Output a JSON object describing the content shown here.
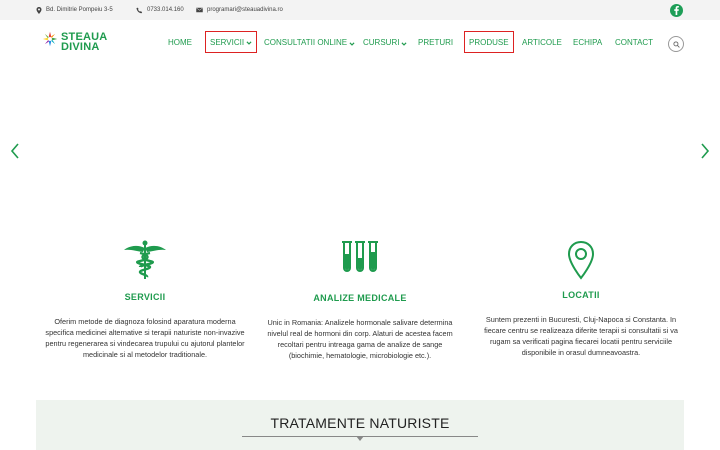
{
  "topbar": {
    "address": "Bd. Dimitrie Pompeiu 3-5",
    "phone": "0733.014.160",
    "email": "programari@steauadivina.ro",
    "social_icon": "facebook-icon"
  },
  "logo": {
    "line1": "STEAUA",
    "line2": "DIVINA"
  },
  "nav": {
    "items": [
      {
        "label": "HOME"
      },
      {
        "label": "SERVICII"
      },
      {
        "label": "CONSULTATII ONLINE"
      },
      {
        "label": "CURSURI"
      },
      {
        "label": "PRETURI"
      },
      {
        "label": "PRODUSE"
      },
      {
        "label": "ARTICOLE"
      },
      {
        "label": "ECHIPA"
      },
      {
        "label": "CONTACT"
      }
    ]
  },
  "features": [
    {
      "icon": "caduceus-icon",
      "title": "SERVICII",
      "text": "Oferim metode de diagnoza folosind aparatura moderna specifica medicinei alternative si terapii naturiste non-invazive pentru regenerarea si vindecarea trupului cu ajutorul plantelor medicinale si al metodelor traditionale."
    },
    {
      "icon": "test-tubes-icon",
      "title": "ANALIZE MEDICALE",
      "text": "Unic in Romania: Analizele hormonale salivare determina nivelul real de hormoni din corp. Alaturi de acestea facem recoltari pentru intreaga gama de analize de sange (biochimie, hematologie, microbiologie etc.)."
    },
    {
      "icon": "location-pin-icon",
      "title": "LOCATII",
      "text": "Suntem prezenti in Bucuresti, Cluj-Napoca si Constanta. In fiecare centru se realizeaza diferite terapii si consultatii si va rugam sa verificati pagina fiecarei locatii pentru serviciile disponibile in orasul dumneavoastra."
    }
  ],
  "section": {
    "heading": "TRATAMENTE NATURISTE"
  },
  "colors": {
    "accent": "#1f9b4e",
    "highlight_box": "#dd2222",
    "topbar_bg": "#f3f3f3",
    "section_bg": "#eef3ee"
  }
}
